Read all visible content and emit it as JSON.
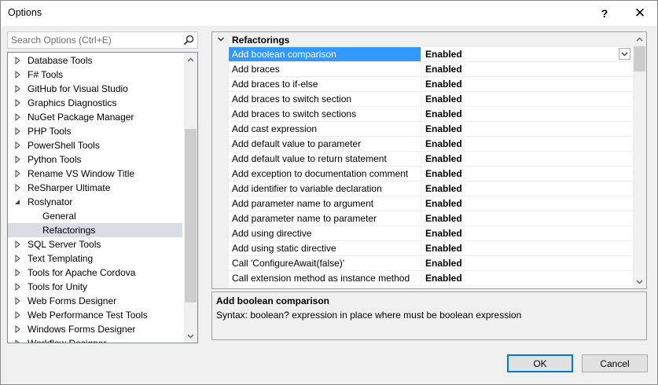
{
  "window": {
    "title": "Options",
    "help_label": "?",
    "close_label": "✕"
  },
  "search": {
    "placeholder": "Search Options (Ctrl+E)"
  },
  "tree": {
    "items": [
      {
        "label": "Database Tools",
        "expander": "collapsed",
        "level": 0
      },
      {
        "label": "F# Tools",
        "expander": "collapsed",
        "level": 0
      },
      {
        "label": "GitHub for Visual Studio",
        "expander": "collapsed",
        "level": 0
      },
      {
        "label": "Graphics Diagnostics",
        "expander": "collapsed",
        "level": 0
      },
      {
        "label": "NuGet Package Manager",
        "expander": "collapsed",
        "level": 0
      },
      {
        "label": "PHP Tools",
        "expander": "collapsed",
        "level": 0
      },
      {
        "label": "PowerShell Tools",
        "expander": "collapsed",
        "level": 0
      },
      {
        "label": "Python Tools",
        "expander": "collapsed",
        "level": 0
      },
      {
        "label": "Rename VS Window Title",
        "expander": "collapsed",
        "level": 0
      },
      {
        "label": "ReSharper Ultimate",
        "expander": "collapsed",
        "level": 0
      },
      {
        "label": "Roslynator",
        "expander": "expanded",
        "level": 0
      },
      {
        "label": "General",
        "expander": "none",
        "level": 1
      },
      {
        "label": "Refactorings",
        "expander": "none",
        "level": 1,
        "selected": true
      },
      {
        "label": "SQL Server Tools",
        "expander": "collapsed",
        "level": 0
      },
      {
        "label": "Text Templating",
        "expander": "collapsed",
        "level": 0
      },
      {
        "label": "Tools for Apache Cordova",
        "expander": "collapsed",
        "level": 0
      },
      {
        "label": "Tools for Unity",
        "expander": "collapsed",
        "level": 0
      },
      {
        "label": "Web Forms Designer",
        "expander": "collapsed",
        "level": 0
      },
      {
        "label": "Web Performance Test Tools",
        "expander": "collapsed",
        "level": 0
      },
      {
        "label": "Windows Forms Designer",
        "expander": "collapsed",
        "level": 0
      },
      {
        "label": "Workflow Designer",
        "expander": "collapsed",
        "level": 0
      }
    ]
  },
  "grid": {
    "category": "Refactorings",
    "rows": [
      {
        "name": "Add boolean comparison",
        "value": "Enabled",
        "selected": true
      },
      {
        "name": "Add braces",
        "value": "Enabled"
      },
      {
        "name": "Add braces to if-else",
        "value": "Enabled"
      },
      {
        "name": "Add braces to switch section",
        "value": "Enabled"
      },
      {
        "name": "Add braces to switch sections",
        "value": "Enabled"
      },
      {
        "name": "Add cast expression",
        "value": "Enabled"
      },
      {
        "name": "Add default value to parameter",
        "value": "Enabled"
      },
      {
        "name": "Add default value to return statement",
        "value": "Enabled"
      },
      {
        "name": "Add exception to documentation comment",
        "value": "Enabled"
      },
      {
        "name": "Add identifier to variable declaration",
        "value": "Enabled"
      },
      {
        "name": "Add parameter name to argument",
        "value": "Enabled"
      },
      {
        "name": "Add parameter name to parameter",
        "value": "Enabled"
      },
      {
        "name": "Add using directive",
        "value": "Enabled"
      },
      {
        "name": "Add using static directive",
        "value": "Enabled"
      },
      {
        "name": "Call 'ConfigureAwait(false)'",
        "value": "Enabled"
      },
      {
        "name": "Call extension method as instance method",
        "value": "Enabled"
      }
    ]
  },
  "description": {
    "title": "Add boolean comparison",
    "text": "Syntax: boolean? expression in place where must be boolean expression"
  },
  "buttons": {
    "ok": "OK",
    "cancel": "Cancel"
  },
  "colors": {
    "selection_blue": "#3399ff",
    "tree_selection": "#dcdce6",
    "ok_border": "#0078d7"
  }
}
